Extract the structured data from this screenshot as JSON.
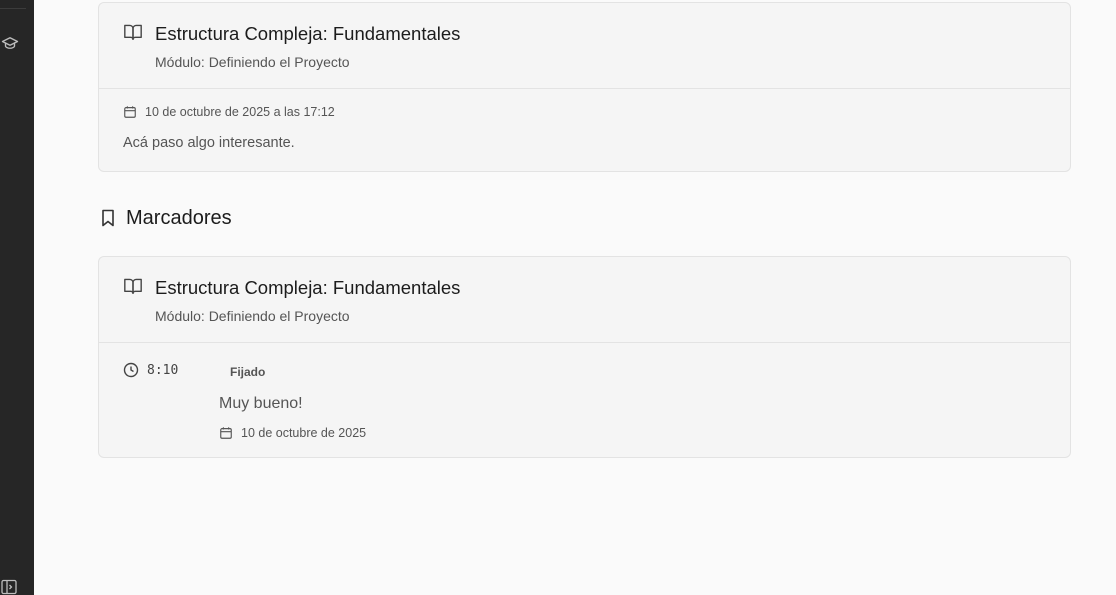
{
  "sidebar": {
    "icons": [
      "graduation-cap-icon",
      "sidebar-toggle-icon"
    ]
  },
  "history_card": {
    "title": "Estructura Compleja: Fundamentales",
    "module": "Módulo: Definiendo el Proyecto",
    "date": "10 de octubre de 2025 a las 17:12",
    "note": "Acá paso algo interesante."
  },
  "bookmarks_section": {
    "title": "Marcadores"
  },
  "bookmark_card": {
    "title": "Estructura Compleja: Fundamentales",
    "module": "Módulo: Definiendo el Proyecto",
    "time": "8:10",
    "pinned_label": "Fijado",
    "note": "Muy bueno!",
    "date": "10 de octubre de 2025"
  }
}
